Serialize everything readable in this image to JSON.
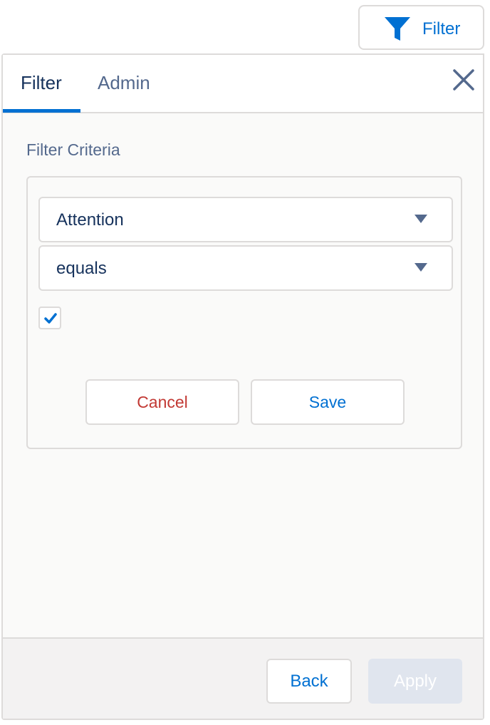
{
  "trigger": {
    "label": "Filter",
    "icon": "filter-funnel-icon"
  },
  "tabs": [
    {
      "label": "Filter",
      "active": true
    },
    {
      "label": "Admin",
      "active": false
    }
  ],
  "criteria": {
    "title": "Filter Criteria",
    "field_value": "Attention",
    "operator_value": "equals",
    "checkbox_checked": true
  },
  "actions": {
    "cancel_label": "Cancel",
    "save_label": "Save"
  },
  "footer": {
    "back_label": "Back",
    "apply_label": "Apply",
    "apply_disabled": true
  },
  "colors": {
    "accent": "#0070d2",
    "danger": "#c23934",
    "text_dark": "#16325c",
    "text_muted": "#54698d",
    "border": "#dddbda",
    "disabled": "#e0e5ee"
  }
}
